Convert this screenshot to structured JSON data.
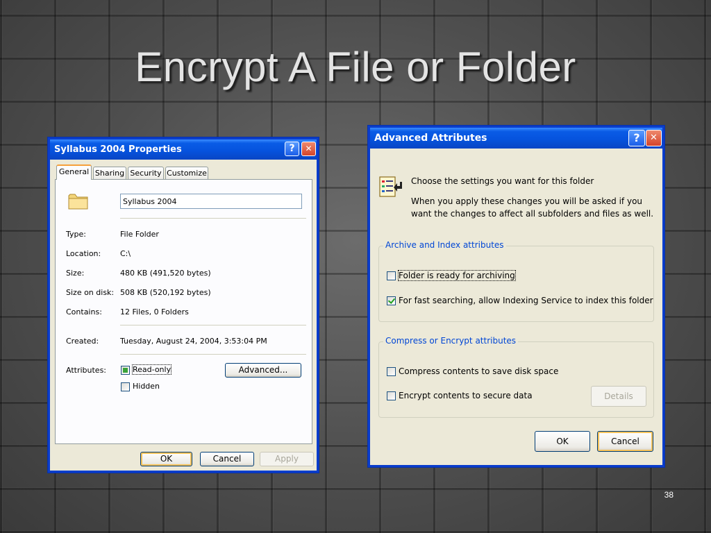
{
  "slide": {
    "title": "Encrypt A File or Folder",
    "page_number": "38"
  },
  "properties_dialog": {
    "title": "Syllabus 2004 Properties",
    "help_glyph": "?",
    "close_glyph": "✕",
    "tabs": [
      "General",
      "Sharing",
      "Security",
      "Customize"
    ],
    "active_tab": "General",
    "folder_icon": "folder-icon",
    "name_value": "Syllabus 2004",
    "fields": [
      {
        "label": "Type:",
        "value": "File Folder"
      },
      {
        "label": "Location:",
        "value": "C:\\"
      },
      {
        "label": "Size:",
        "value": "480 KB (491,520 bytes)"
      },
      {
        "label": "Size on disk:",
        "value": "508 KB (520,192 bytes)"
      },
      {
        "label": "Contains:",
        "value": "12 Files, 0 Folders"
      }
    ],
    "created": {
      "label": "Created:",
      "value": "Tuesday, August 24, 2004, 3:53:04 PM"
    },
    "attributes_label": "Attributes:",
    "readonly_label": "Read-only",
    "readonly_state": "indeterminate",
    "hidden_label": "Hidden",
    "hidden_checked": false,
    "advanced_button": "Advanced...",
    "ok_button": "OK",
    "cancel_button": "Cancel",
    "apply_button": "Apply"
  },
  "advanced_dialog": {
    "title": "Advanced Attributes",
    "help_glyph": "?",
    "close_glyph": "✕",
    "icon": "attributes-icon",
    "intro_heading": "Choose the settings you want for this folder",
    "intro_text": "When you apply these changes you will be asked if you want the changes to affect all subfolders and files as well.",
    "archive_group_title": "Archive and Index attributes",
    "archive_label": "Folder is ready for archiving",
    "archive_checked": false,
    "index_label": "For fast searching, allow Indexing Service to index this folder",
    "index_checked": true,
    "compress_group_title": "Compress or Encrypt attributes",
    "compress_label": "Compress contents to save disk space",
    "compress_checked": false,
    "encrypt_label": "Encrypt contents to secure data",
    "encrypt_checked": false,
    "details_button": "Details",
    "ok_button": "OK",
    "cancel_button": "Cancel"
  },
  "colors": {
    "titlebar_blue": "#0653de",
    "dialog_face": "#ece9d8",
    "group_title_blue": "#0046d5",
    "check_green": "#21a121"
  }
}
